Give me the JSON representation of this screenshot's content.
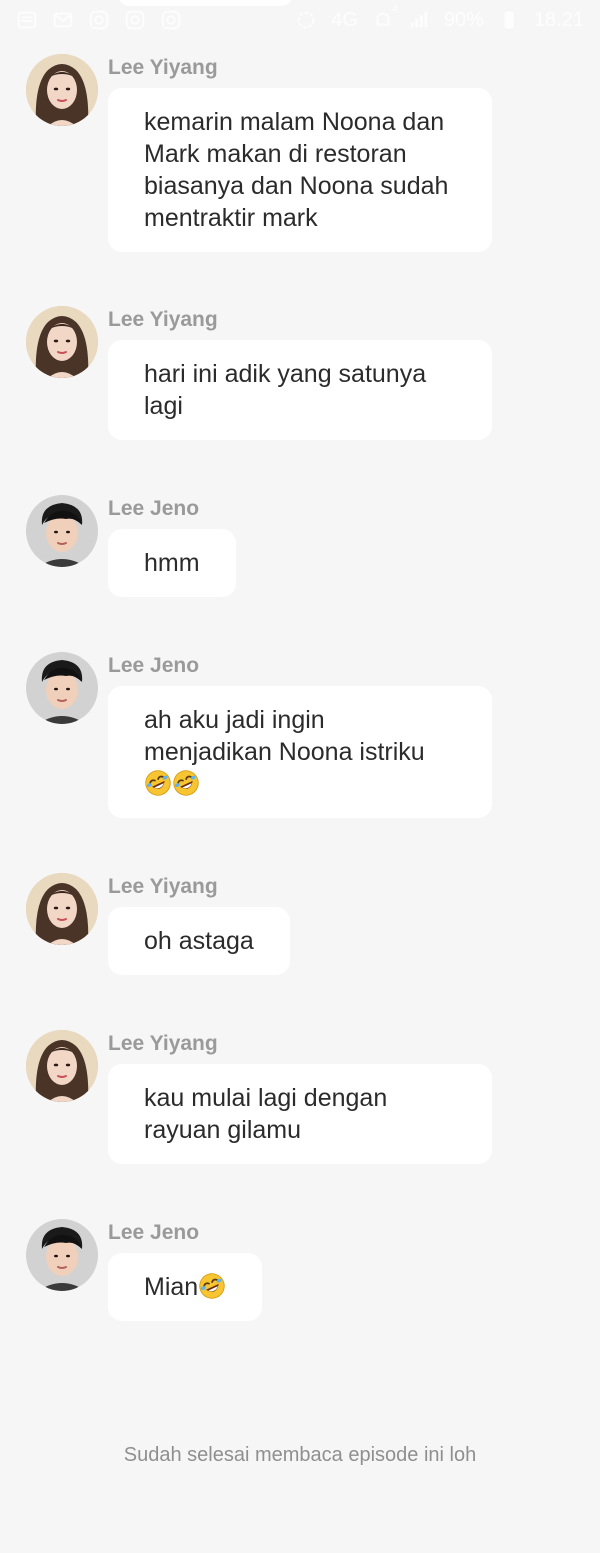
{
  "status_bar": {
    "battery": "90%",
    "time": "18.21",
    "network": "4G",
    "notification_count": "4",
    "icons": [
      "news-icon",
      "mail-icon",
      "instagram-icon",
      "instagram-icon",
      "instagram-icon",
      "sync-icon",
      "network-icon",
      "notification-icon",
      "signal-icon",
      "signal-icon",
      "battery-icon"
    ]
  },
  "messages": [
    {
      "sender": "Lee Yiyang",
      "avatar": "female-avatar",
      "text": "kemarin malam Noona dan Mark makan di restoran biasanya dan Noona sudah mentraktir mark",
      "emoji_count": 0
    },
    {
      "sender": "Lee Yiyang",
      "avatar": "female-avatar",
      "text": "hari ini adik yang satunya lagi",
      "emoji_count": 0
    },
    {
      "sender": "Lee Jeno",
      "avatar": "male-avatar",
      "text": "hmm",
      "emoji_count": 0
    },
    {
      "sender": "Lee Jeno",
      "avatar": "male-avatar",
      "text": "ah aku jadi ingin menjadikan Noona istriku",
      "emoji_count": 2,
      "emoji": "rolling-on-floor-laughing"
    },
    {
      "sender": "Lee Yiyang",
      "avatar": "female-avatar",
      "text": "oh astaga",
      "emoji_count": 0
    },
    {
      "sender": "Lee Yiyang",
      "avatar": "female-avatar",
      "text": "kau mulai lagi dengan rayuan gilamu",
      "emoji_count": 0
    },
    {
      "sender": "Lee Jeno",
      "avatar": "male-avatar",
      "text": "Mian",
      "emoji_count": 1,
      "emoji": "rolling-on-floor-laughing"
    }
  ],
  "footer_text": "Sudah selesai membaca episode ini loh",
  "colors": {
    "background": "#f6f6f6",
    "bubble": "#ffffff",
    "sender": "#9a9a9a",
    "text": "#2b2b2b",
    "footer": "#8f8f8f"
  }
}
